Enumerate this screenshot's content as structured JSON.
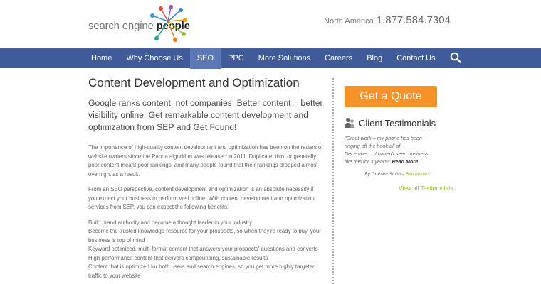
{
  "header": {
    "logo_prefix": "search engine ",
    "logo_brand": "people",
    "phone_region": "North America",
    "phone_number": "1.877.584.7304"
  },
  "nav": {
    "items": [
      "Home",
      "Why Choose Us",
      "SEO",
      "PPC",
      "More Solutions",
      "Careers",
      "Blog",
      "Contact Us"
    ],
    "active": "SEO",
    "search_icon": "search-icon"
  },
  "main": {
    "title": "Content Development and Optimization",
    "lead": "Google ranks content, not companies. Better content = better visibility online. Get remarkable content development and optimization from SEP and Get Found!",
    "paragraphs": [
      "The importance of high-quality content development and optimization has been on the radars of website owners since the Panda algorithm was released in 2011. Duplicate, thin, or generally poor content meant poor rankings, and many people found that their rankings dropped almost overnight as a result.",
      "From an SEO perspective, content development and optimization is an absolute necessity if you expect your business to perform well online. With content development and optimization services from SEP, you can expect the following benefits:"
    ],
    "benefits": [
      "Build brand authority and become a thought leader in your industry",
      "Become the trusted knowledge resource for your prospects, so when they're ready to buy, your business is top of mind",
      "Keyword optimized, multi-format content that answers your prospects' questions and converts",
      "High-performance content that delivers compounding, sustainable results",
      "Content that is optimized for both users and search engines, so you get more highly targeted traffic to your website"
    ]
  },
  "sidebar": {
    "quote_button": "Get a Quote",
    "testimonials_title": "Client Testimonials",
    "testimonial_text": "\"Great work – my phone has been ringing off the hook all of December.... I haven't seen business like this for 3 years!\"",
    "read_more": "Read More",
    "author_prefix": "By Graham Smith – ",
    "company": "Barkbusters",
    "all_link": "View all Testimonials"
  },
  "colors": {
    "nav_bg": "#3f5b9a",
    "nav_active": "#5a78b5",
    "quote_button": "#f6922a",
    "link_green": "#8dbd2d"
  }
}
